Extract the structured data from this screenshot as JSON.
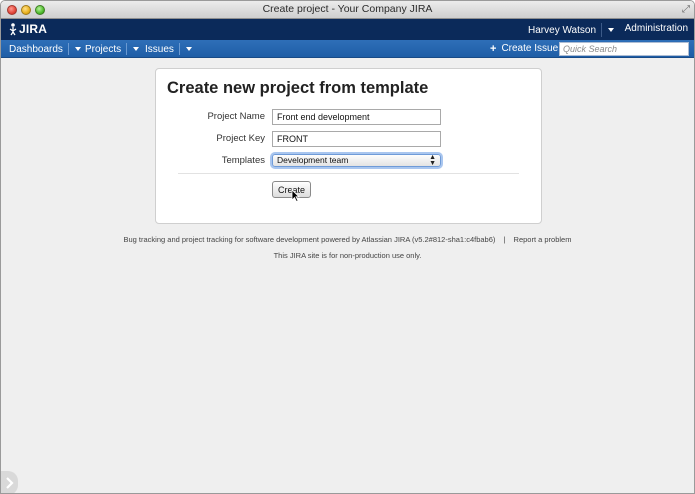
{
  "window": {
    "title": "Create project - Your Company JIRA"
  },
  "header": {
    "logo_text": "JIRA",
    "user_name": "Harvey Watson",
    "admin_label": "Administration"
  },
  "nav": {
    "items": [
      {
        "label": "Dashboards"
      },
      {
        "label": "Projects"
      },
      {
        "label": "Issues"
      }
    ],
    "create_issue_label": "Create Issue",
    "search_placeholder": "Quick Search"
  },
  "form": {
    "heading": "Create new project from template",
    "project_name_label": "Project Name",
    "project_name_value": "Front end development",
    "project_key_label": "Project Key",
    "project_key_value": "FRONT",
    "templates_label": "Templates",
    "templates_selected": "Development team",
    "create_label": "Create"
  },
  "footer": {
    "powered_text": "Bug tracking and project tracking for software development powered by Atlassian JIRA (v5.2#812-sha1:c4fbab6)",
    "separator": "|",
    "report_link": "Report a problem",
    "notice": "This JIRA site is for non-production use only."
  },
  "colors": {
    "header_bg": "#0b2a5a",
    "nav_bg": "#2566ae",
    "page_bg": "#efefef"
  }
}
